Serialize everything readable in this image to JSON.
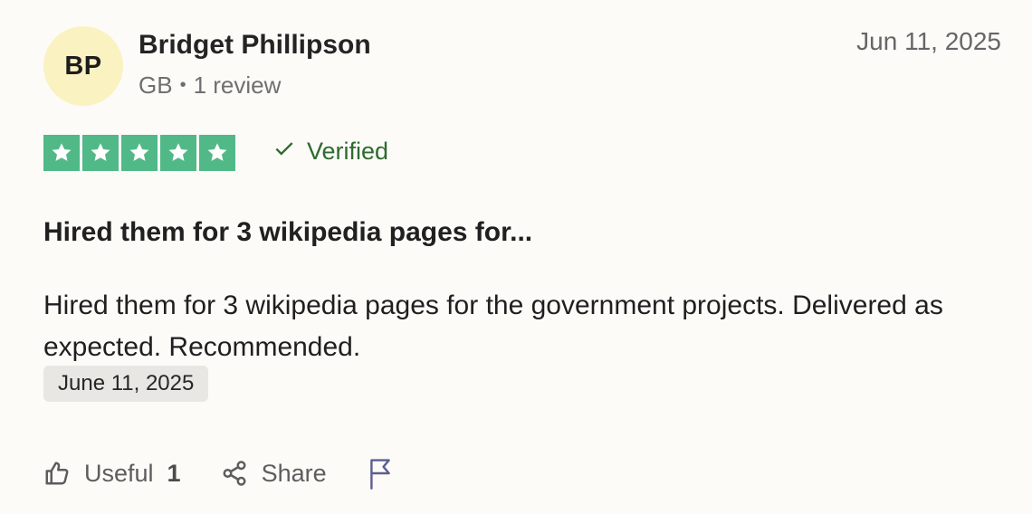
{
  "review": {
    "avatar_initials": "BP",
    "reviewer_name": "Bridget Phillipson",
    "country": "GB",
    "separator": "•",
    "review_count": "1 review",
    "date": "Jun 11, 2025",
    "rating": 5,
    "verified_label": "Verified",
    "title": "Hired them for 3 wikipedia pages for...",
    "body": "Hired them for 3 wikipedia pages for the government projects. Delivered as expected. Recommended.",
    "experience_date": "June 11, 2025",
    "useful_label": "Useful",
    "useful_count": "1",
    "share_label": "Share",
    "colors": {
      "star_background": "#51b987",
      "verified": "#2e6b2e",
      "avatar_background": "#fbf2c2"
    },
    "icons": [
      "star-icon",
      "check-icon",
      "thumbs-up-icon",
      "share-icon",
      "flag-icon"
    ]
  }
}
